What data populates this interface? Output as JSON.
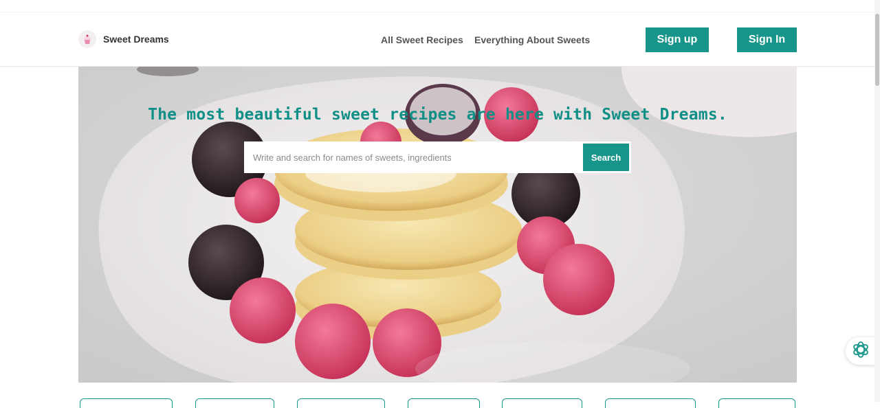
{
  "header": {
    "brand_name": "Sweet Dreams",
    "nav": [
      {
        "label": "All Sweet Recipes"
      },
      {
        "label": "Everything About Sweets"
      }
    ],
    "signup_label": "Sign up",
    "signin_label": "Sign In"
  },
  "hero": {
    "title": "The most beautiful sweet recipes are here with Sweet Dreams.",
    "search_placeholder": "Write and search for names of sweets, ingredients",
    "search_button": "Search"
  },
  "icons": {
    "brand": "cupcake-icon",
    "chat": "ai-assistant-icon"
  },
  "colors": {
    "accent": "#17958a",
    "title": "#0f8f86"
  }
}
